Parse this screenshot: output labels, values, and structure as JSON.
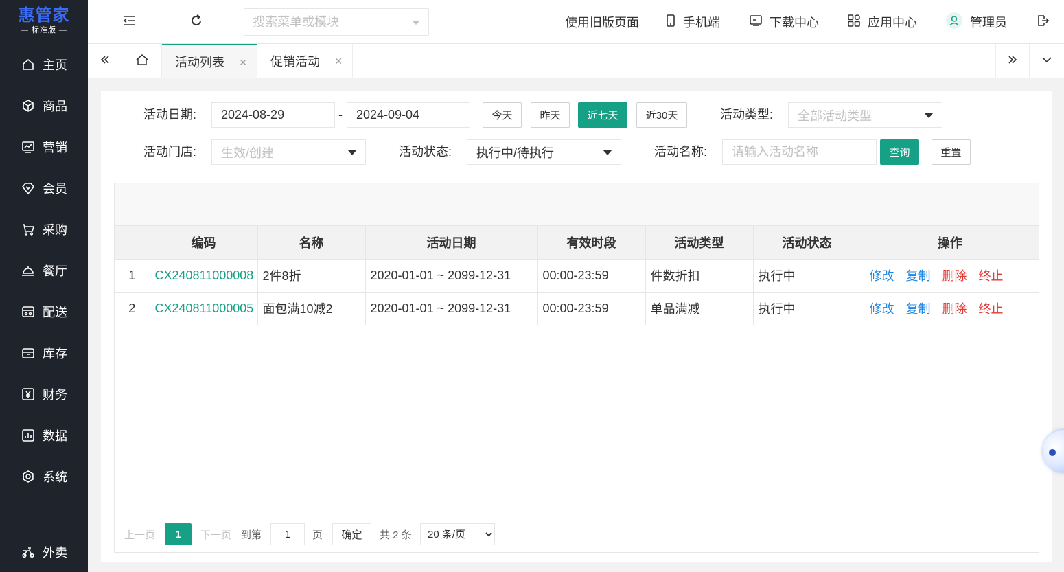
{
  "brand": {
    "name": "惠管家",
    "edition": "标准版"
  },
  "sidebar": {
    "items": [
      {
        "label": "主页",
        "icon": "home-icon"
      },
      {
        "label": "商品",
        "icon": "cube-icon"
      },
      {
        "label": "营销",
        "icon": "chart-trend-icon"
      },
      {
        "label": "会员",
        "icon": "diamond-icon"
      },
      {
        "label": "采购",
        "icon": "cart-icon"
      },
      {
        "label": "餐厅",
        "icon": "cloche-icon"
      },
      {
        "label": "配送",
        "icon": "delivery-icon"
      },
      {
        "label": "库存",
        "icon": "box-icon"
      },
      {
        "label": "财务",
        "icon": "yuan-icon"
      },
      {
        "label": "数据",
        "icon": "bar-chart-icon"
      },
      {
        "label": "系统",
        "icon": "gear-icon"
      }
    ],
    "bottom": {
      "label": "外卖",
      "icon": "scooter-icon"
    }
  },
  "header": {
    "search_placeholder": "搜索菜单或模块",
    "old_version": "使用旧版页面",
    "mobile": "手机端",
    "download": "下载中心",
    "apps": "应用中心",
    "user": "管理员"
  },
  "tabs": [
    {
      "label": "活动列表",
      "active": true
    },
    {
      "label": "促销活动",
      "active": false
    }
  ],
  "filters": {
    "date_label": "活动日期:",
    "date_start": "2024-08-29",
    "date_sep": "-",
    "date_end": "2024-09-04",
    "quick": [
      "今天",
      "昨天",
      "近七天",
      "近30天"
    ],
    "type_label": "活动类型:",
    "type_placeholder": "全部活动类型",
    "store_label": "活动门店:",
    "store_placeholder": "生效/创建",
    "status_label": "活动状态:",
    "status_value": "执行中/待执行",
    "name_label": "活动名称:",
    "name_placeholder": "请输入活动名称",
    "search_btn": "查询",
    "reset_btn": "重置"
  },
  "table": {
    "headers": [
      "",
      "编码",
      "名称",
      "活动日期",
      "有效时段",
      "活动类型",
      "活动状态",
      "操作"
    ],
    "rows": [
      {
        "no": "1",
        "code": "CX240811000008",
        "name": "2件8折",
        "date": "2020-01-01 ~ 2099-12-31",
        "period": "00:00-23:59",
        "type": "件数折扣",
        "status": "执行中"
      },
      {
        "no": "2",
        "code": "CX240811000005",
        "name": "面包满10减2",
        "date": "2020-01-01 ~ 2099-12-31",
        "period": "00:00-23:59",
        "type": "单品满减",
        "status": "执行中"
      }
    ],
    "actions": {
      "edit": "修改",
      "copy": "复制",
      "delete": "删除",
      "stop": "终止"
    }
  },
  "pager": {
    "prev": "上一页",
    "current": "1",
    "next": "下一页",
    "goto": "到第",
    "goto_value": "1",
    "page_unit": "页",
    "confirm": "确定",
    "total": "共 2 条",
    "page_size": "20 条/页"
  },
  "colors": {
    "accent": "#16a085",
    "sidebar": "#1f232b",
    "brand": "#3b6cf6",
    "link_blue": "#1e88e5",
    "link_red": "#e53935"
  }
}
